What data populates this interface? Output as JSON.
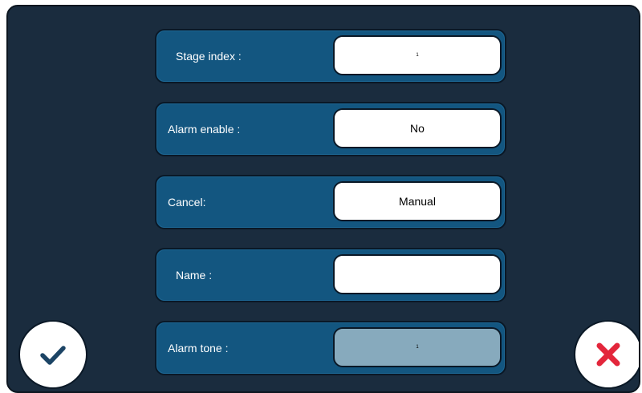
{
  "form": {
    "rows": [
      {
        "label": "Stage index :",
        "value": "1"
      },
      {
        "label": "Alarm enable :",
        "value": "No"
      },
      {
        "label": "Cancel:",
        "value": "Manual"
      },
      {
        "label": "Name :",
        "value": ""
      },
      {
        "label": "Alarm tone :",
        "value": "1"
      }
    ]
  },
  "buttons": {
    "confirm_icon": "checkmark-icon",
    "cancel_icon": "close-icon"
  },
  "colors": {
    "background": "#1a2c3e",
    "row_fill": "#135680",
    "field_fill": "#ffffff",
    "field_disabled": "#87aabd",
    "confirm_icon": "#1c4465",
    "cancel_icon": "#e3263b"
  }
}
